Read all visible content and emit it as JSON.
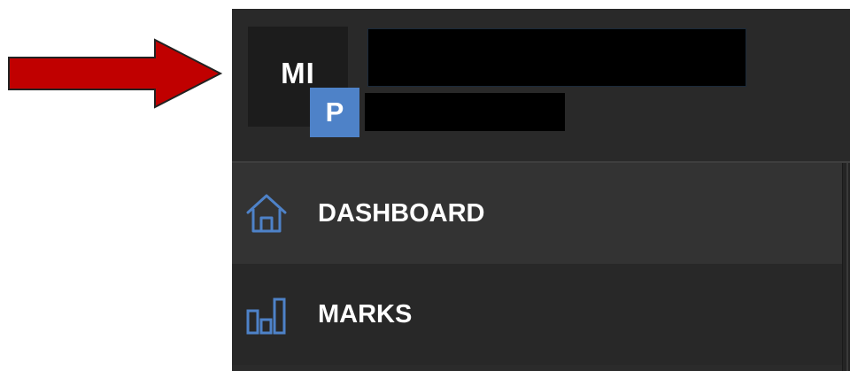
{
  "user": {
    "initials": "MI",
    "badge": "P"
  },
  "nav": {
    "items": [
      {
        "label": "DASHBOARD",
        "icon": "home-icon",
        "active": true
      },
      {
        "label": "MARKS",
        "icon": "bar-chart-icon",
        "active": false
      }
    ]
  },
  "colors": {
    "arrow": "#c00000",
    "accent": "#4e82c8",
    "sidebar_bg": "#2b2b2b",
    "text": "#ffffff"
  }
}
